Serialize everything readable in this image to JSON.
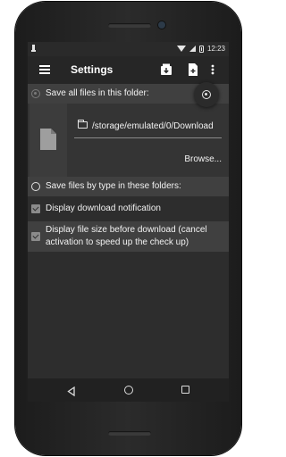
{
  "status_bar": {
    "left_icon": "notification-icon",
    "time": "12:23"
  },
  "app_bar": {
    "title": "Settings",
    "actions": [
      "download-box-icon",
      "file-add-icon",
      "more-vert-icon"
    ]
  },
  "settings": {
    "save_all_label": "Save all files in this folder:",
    "save_all_selected": true,
    "folder_path": "/storage/emulated/0/Download",
    "browse_label": "Browse...",
    "save_by_type_label": "Save files by type in these folders:",
    "save_by_type_selected": false,
    "display_notification_label": "Display download notification",
    "display_notification_checked": true,
    "display_file_size_label_line1": "Display file size before download (cancel",
    "display_file_size_label_line2": "activation to speed up the check up)",
    "display_file_size_checked": true
  },
  "navigation": {
    "back": "back-icon",
    "home": "home-icon",
    "recents": "recents-icon"
  },
  "colors": {
    "app_bar": "#262626",
    "background": "#2d2d2d",
    "highlight_row": "#404040",
    "text": "#f2f2f2"
  }
}
